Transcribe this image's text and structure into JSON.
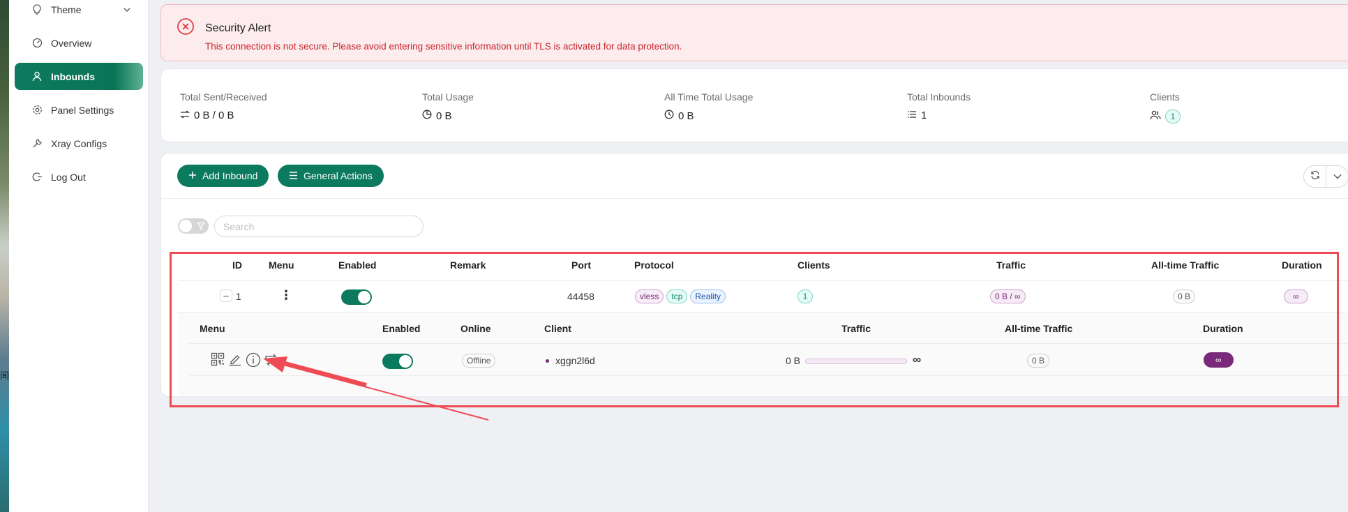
{
  "sidebar": {
    "items": [
      {
        "id": "theme",
        "label": "Theme",
        "icon": "bulb-icon"
      },
      {
        "id": "overview",
        "label": "Overview",
        "icon": "dashboard-icon"
      },
      {
        "id": "inbounds",
        "label": "Inbounds",
        "icon": "user-icon",
        "active": true
      },
      {
        "id": "panel-settings",
        "label": "Panel Settings",
        "icon": "gear-icon"
      },
      {
        "id": "xray-configs",
        "label": "Xray Configs",
        "icon": "tool-icon"
      },
      {
        "id": "log-out",
        "label": "Log Out",
        "icon": "logout-icon"
      }
    ]
  },
  "photo_text": "间",
  "alert": {
    "title": "Security Alert",
    "message": "This connection is not secure. Please avoid entering sensitive information until TLS is activated for data protection.",
    "close": "×"
  },
  "stats": [
    {
      "label": "Total Sent/Received",
      "value": "0 B / 0 B",
      "icon": "swap-icon"
    },
    {
      "label": "Total Usage",
      "value": "0 B",
      "icon": "pie-icon"
    },
    {
      "label": "All Time Total Usage",
      "value": "0 B",
      "icon": "clock-icon"
    },
    {
      "label": "Total Inbounds",
      "value": "1",
      "icon": "list-icon"
    },
    {
      "label": "Clients",
      "value": "1",
      "icon": "team-icon"
    }
  ],
  "toolbar": {
    "add_inbound": "Add Inbound",
    "general_actions": "General Actions"
  },
  "search": {
    "placeholder": "Search",
    "value": ""
  },
  "table": {
    "headers": [
      "ID",
      "Menu",
      "Enabled",
      "Remark",
      "Port",
      "Protocol",
      "Clients",
      "Traffic",
      "All-time Traffic",
      "Duration"
    ],
    "row": {
      "expand": "–",
      "id": "1",
      "menu": "⋮",
      "remark": "",
      "port": "44458",
      "protocol_tags": [
        "vless",
        "tcp",
        "Reality"
      ],
      "clients": "1",
      "traffic": "0 B / ∞",
      "all_time_traffic": "0 B",
      "duration": "∞"
    }
  },
  "client_table": {
    "headers": [
      "Menu",
      "Enabled",
      "Online",
      "Client",
      "Traffic",
      "All-time Traffic",
      "Duration"
    ],
    "row": {
      "online": "Offline",
      "client": "xggn2l6d",
      "traffic_used": "0 B",
      "traffic_limit": "∞",
      "traffic_fraction": 0,
      "all_time_traffic": "0 B",
      "duration": "∞"
    }
  },
  "colors": {
    "accent": "#0c7a5e",
    "alert_bg": "#fdeced",
    "alert_text": "#c8252c",
    "highlight": "#ef4b55",
    "purple": "#7a2a7a"
  }
}
